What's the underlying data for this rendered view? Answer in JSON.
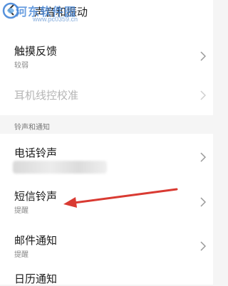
{
  "header": {
    "title": "声音和振动",
    "watermark_brand": "河东软件园",
    "watermark_url": "www.pc0359.cn"
  },
  "settings": {
    "touch_feedback": {
      "label": "触摸反馈",
      "value": "较弱"
    },
    "earphone_calibration": {
      "label": "耳机线控校准"
    },
    "section_ringtones": "铃声和通知",
    "phone_ringtone": {
      "label": "电话铃声"
    },
    "sms_ringtone": {
      "label": "短信铃声",
      "value": "提醒"
    },
    "email_notification": {
      "label": "邮件通知",
      "value": "提醒"
    },
    "calendar_notification": {
      "label": "日历通知"
    }
  },
  "colors": {
    "annotation_arrow": "#d93a32",
    "watermark": "#3a7fd6"
  },
  "icons": {
    "chevron": "chevron-right-icon",
    "back": "back-arrow-icon"
  }
}
